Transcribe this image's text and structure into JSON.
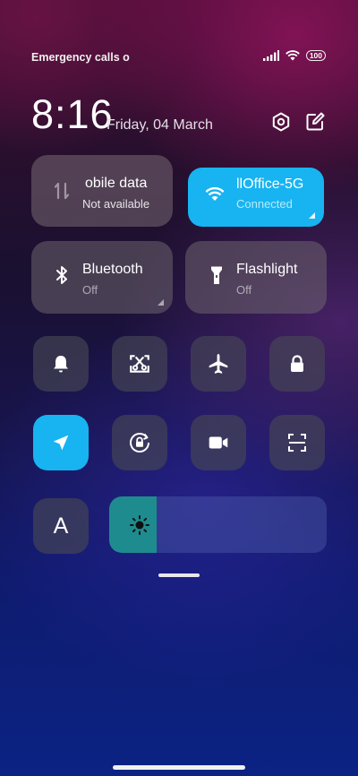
{
  "status_bar": {
    "carrier_text": "Emergency calls o",
    "battery": "100"
  },
  "header": {
    "time": "8:16",
    "date": "Friday, 04 March"
  },
  "tiles": {
    "mobile_data": {
      "title": "obile data",
      "subtitle": "Not available",
      "icon": "mobile-data-icon"
    },
    "wifi": {
      "title": "llOffice-5G",
      "subtitle": "Connected",
      "icon": "wifi-icon",
      "active_color": "#17b4f1"
    },
    "bluetooth": {
      "title": "Bluetooth",
      "subtitle": "Off",
      "icon": "bluetooth-icon"
    },
    "flashlight": {
      "title": "Flashlight",
      "subtitle": "Off",
      "icon": "flashlight-icon"
    }
  },
  "toggles_row1": [
    "bell-icon",
    "screenshot-icon",
    "airplane-icon",
    "lock-icon"
  ],
  "toggles_row2": [
    "location-icon",
    "rotation-lock-icon",
    "video-camera-icon",
    "scan-icon"
  ],
  "font_button_label": "A",
  "brightness": {
    "level": 0.22,
    "icon": "sun-icon"
  }
}
